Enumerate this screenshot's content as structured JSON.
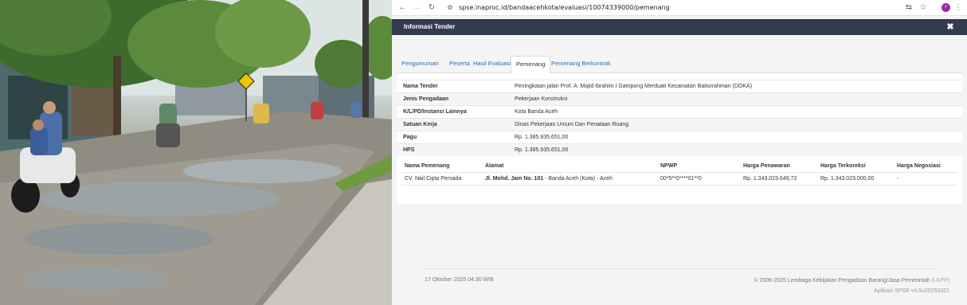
{
  "browser": {
    "url": "spse.inaproc.id/bandaacehkota/evaluasi/10074339000/pemenang",
    "profile_initial": "r",
    "icons": [
      "back-arrow-icon",
      "forward-arrow-icon",
      "reload-icon",
      "site-info-icon",
      "translate-icon",
      "bookmark-star-icon",
      "kebab-menu-icon"
    ]
  },
  "modal": {
    "title": "Informasi Tender",
    "close": "✖"
  },
  "tabs": [
    {
      "label": "Pengumuman",
      "active": false
    },
    {
      "label": "Peserta",
      "active": false
    },
    {
      "label": "Hasil Evaluasi",
      "active": false
    },
    {
      "label": "Pemenang",
      "active": true
    },
    {
      "label": "Pemenang Berkontrak",
      "active": false
    }
  ],
  "info": [
    {
      "label": "Nama Tender",
      "value": "Peningkatan jalan Prof. A. Majid Ibrahim I Gampong Merduati Kecamatan Baiturrahman (DOKA)"
    },
    {
      "label": "Jenis Pengadaan",
      "value": "Pekerjaan Konstruksi"
    },
    {
      "label": "K/L/PD/Instansi Lainnya",
      "value": "Kota Banda Aceh"
    },
    {
      "label": "Satuan Kerja",
      "value": "Dinas Pekerjaan Umum Dan Penataan Ruang"
    },
    {
      "label": "Pagu",
      "value": "Rp. 1.385.935.651,00"
    },
    {
      "label": "HPS",
      "value": "Rp. 1.385.935.651,00"
    }
  ],
  "winners": {
    "headers": [
      "Nama Pemenang",
      "Alamat",
      "NPWP",
      "Harga Penawaran",
      "Harga Terkoreksi",
      "Harga Negosiasi"
    ],
    "rows": [
      {
        "nama": "CV. Nail Cipta Persada",
        "alamat_bold": "Jl. Mohd. Jam No. 101",
        "alamat_rest": " - Banda Aceh (Kota) - Aceh",
        "npwp": "00*5**0****01**0",
        "penawaran": "Rp. 1.343.023.649,72",
        "terkoreksi": "Rp. 1.343.023.000,00",
        "negosiasi": "-"
      }
    ]
  },
  "footer": {
    "date": "17 Oktober 2025 04:30 WIB",
    "copyright": "© 2006-2025 Lembaga Kebijakan Pengadaan Barang/Jasa Pemerintah",
    "lkpp": "(LKPP)",
    "version": "Aplikasi SPSE v4.5u20250321"
  },
  "colors": {
    "modal_header": "#333c4e",
    "tab_link": "#2a6fb5",
    "profile": "#9c27b0"
  }
}
